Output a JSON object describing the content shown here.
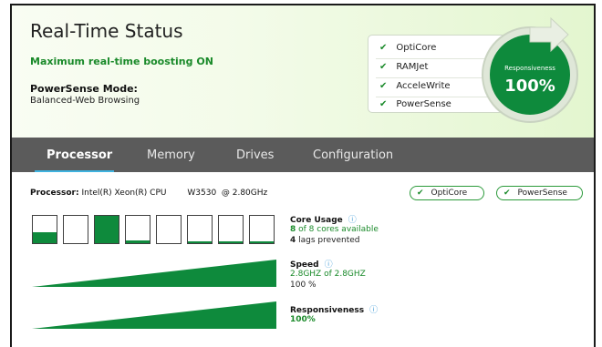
{
  "header": {
    "title": "Real-Time Status",
    "boost_status": "Maximum real-time boosting ON",
    "powersense_label": "PowerSense Mode:",
    "powersense_value": "Balanced-Web Browsing",
    "features": [
      "OptiCore",
      "RAMJet",
      "AcceleWrite",
      "PowerSense"
    ],
    "gauge": {
      "label": "Responsiveness",
      "value": "100%"
    }
  },
  "tabs": [
    "Processor",
    "Memory",
    "Drives",
    "Configuration"
  ],
  "active_tab": "Processor",
  "processor": {
    "label": "Processor:",
    "value": "Intel(R) Xeon(R) CPU        W3530  @ 2.80GHz",
    "pills": [
      "OptiCore",
      "PowerSense"
    ]
  },
  "core_usage": {
    "title": "Core Usage",
    "available_count": "8",
    "available_text": "of 8 cores available",
    "lags_count": "4",
    "lags_text": "lags prevented",
    "loads": [
      0.4,
      0.0,
      1.0,
      0.1,
      0.0,
      0.05,
      0.05,
      0.08
    ]
  },
  "speed": {
    "title": "Speed",
    "value": "2.8GHZ of 2.8GHZ",
    "percent": "100 %"
  },
  "responsiveness": {
    "title": "Responsiveness",
    "value": "100%"
  },
  "colors": {
    "accent_green": "#0e8a3c",
    "text_green": "#1a8a2a",
    "tab_bar": "#5b5b5b",
    "tab_underline": "#3fb3e0",
    "info_blue": "#3f9bd8"
  }
}
